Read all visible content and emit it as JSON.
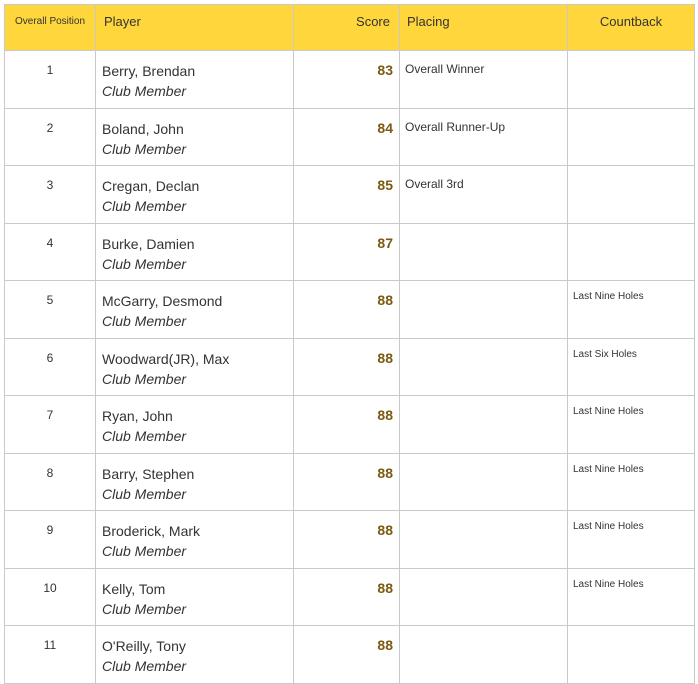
{
  "headers": {
    "position": "Overall Position",
    "player": "Player",
    "score": "Score",
    "placing": "Placing",
    "countback": "Countback"
  },
  "rows": [
    {
      "pos": "1",
      "name": "Berry, Brendan",
      "club": "Club Member",
      "score": "83",
      "placing": "Overall Winner",
      "countback": ""
    },
    {
      "pos": "2",
      "name": "Boland, John",
      "club": "Club Member",
      "score": "84",
      "placing": "Overall Runner-Up",
      "countback": ""
    },
    {
      "pos": "3",
      "name": "Cregan, Declan",
      "club": "Club Member",
      "score": "85",
      "placing": "Overall 3rd",
      "countback": ""
    },
    {
      "pos": "4",
      "name": "Burke, Damien",
      "club": "Club Member",
      "score": "87",
      "placing": "",
      "countback": ""
    },
    {
      "pos": "5",
      "name": "McGarry, Desmond",
      "club": "Club Member",
      "score": "88",
      "placing": "",
      "countback": "Last Nine Holes"
    },
    {
      "pos": "6",
      "name": "Woodward(JR), Max",
      "club": "Club Member",
      "score": "88",
      "placing": "",
      "countback": "Last Six Holes"
    },
    {
      "pos": "7",
      "name": "Ryan, John",
      "club": "Club Member",
      "score": "88",
      "placing": "",
      "countback": "Last Nine Holes"
    },
    {
      "pos": "8",
      "name": "Barry, Stephen",
      "club": "Club Member",
      "score": "88",
      "placing": "",
      "countback": "Last Nine Holes"
    },
    {
      "pos": "9",
      "name": "Broderick, Mark",
      "club": "Club Member",
      "score": "88",
      "placing": "",
      "countback": "Last Nine Holes"
    },
    {
      "pos": "10",
      "name": "Kelly, Tom",
      "club": "Club Member",
      "score": "88",
      "placing": "",
      "countback": "Last Nine Holes"
    },
    {
      "pos": "11",
      "name": "O'Reilly, Tony",
      "club": "Club Member",
      "score": "88",
      "placing": "",
      "countback": ""
    }
  ]
}
